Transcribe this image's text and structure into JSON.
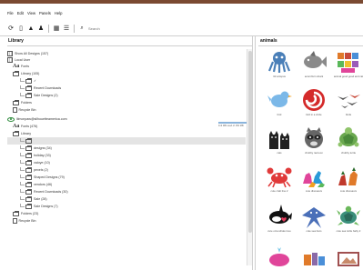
{
  "menu": [
    "File",
    "Edit",
    "View",
    "Panels",
    "Help"
  ],
  "toolbar": {
    "search_placeholder": "Search",
    "icons": [
      "sync-icon",
      "device-icon",
      "upload-icon",
      "user-icon",
      "grid-view-icon",
      "list-view-icon"
    ]
  },
  "library": {
    "title": "Library",
    "rows": [
      {
        "label": "Show All Designs (157)",
        "icon": "grid"
      },
      {
        "label": "Local User",
        "icon": "grid"
      },
      {
        "label": "Fonts",
        "icon": "font"
      },
      {
        "label": "Library (105)",
        "icon": "folder"
      },
      {
        "label": "✓",
        "icon": "folder"
      },
      {
        "label": "Recent Downloads",
        "icon": "folder"
      },
      {
        "label": "Sale Designs (2)",
        "icon": "folder"
      },
      {
        "label": "Folders",
        "icon": "folder"
      },
      {
        "label": "Recycle Bin",
        "icon": "bin"
      },
      {
        "label": "lilmonpaw@silhouetteamerica.com",
        "icon": "eye"
      },
      {
        "label": "Fonts (476)",
        "icon": "font"
      },
      {
        "label": "Library",
        "icon": "folder"
      },
      {
        "label": "",
        "icon": "folder"
      },
      {
        "label": "designs (34)",
        "icon": "folder"
      },
      {
        "label": "holiday (33)",
        "icon": "folder"
      },
      {
        "label": "valoye (10)",
        "icon": "folder"
      },
      {
        "label": "pexels (2)",
        "icon": "folder"
      },
      {
        "label": "Shaped Designs (79)",
        "icon": "folder"
      },
      {
        "label": "vendors (46)",
        "icon": "folder"
      },
      {
        "label": "Recent Downloads (30)",
        "icon": "folder"
      },
      {
        "label": "Sale (28)",
        "icon": "folder"
      },
      {
        "label": "Sale Designs (7)",
        "icon": "folder"
      },
      {
        "label": "Folders (23)",
        "icon": "folder"
      },
      {
        "label": "Recycle Bin",
        "icon": "bin"
      }
    ],
    "storage": {
      "label": "113 MB used of 150 MB",
      "fraction": 0.75
    }
  },
  "animals": {
    "title": "animals",
    "items": [
      {
        "label": "3d octopus",
        "color": "#4a7fb8",
        "shape": "octopus"
      },
      {
        "label": "acorn/fern shark",
        "color": "#8a8a8a",
        "shape": "fish"
      },
      {
        "label": "animal good good and cat",
        "color": "#c84a3a",
        "shape": "blocks"
      },
      {
        "label": "bird",
        "color": "#7bb8e8",
        "shape": "bird"
      },
      {
        "label": "bird in a circle",
        "color": "#d42a2a",
        "shape": "swirl"
      },
      {
        "label": "birds",
        "color": "#555555",
        "shape": "birds"
      },
      {
        "label": "cats",
        "color": "#222222",
        "shape": "cats"
      },
      {
        "label": "chubby raccoon",
        "color": "#666666",
        "shape": "raccoon"
      },
      {
        "label": "chubby turtle",
        "color": "#6aa84f",
        "shape": "turtle"
      },
      {
        "label": "cute crab line 2",
        "color": "#e03a3a",
        "shape": "crab"
      },
      {
        "label": "cute dinosaurs",
        "color": "#e0459a",
        "shape": "dinos"
      },
      {
        "label": "cute dinosaurs",
        "color": "#c0392b",
        "shape": "dinos2"
      },
      {
        "label": "cute orca whale love",
        "color": "#111111",
        "shape": "orca"
      },
      {
        "label": "cute sea lions",
        "color": "#4a6fb8",
        "shape": "ray"
      },
      {
        "label": "cute sea turtle baby 2",
        "color": "#3a8f7a",
        "shape": "seaturtle"
      },
      {
        "label": "",
        "color": "#e0459a",
        "shape": "whale"
      },
      {
        "label": "",
        "color": "#8a6aa8",
        "shape": "misc"
      },
      {
        "label": "",
        "color": "#a05050",
        "shape": "frame"
      }
    ]
  }
}
